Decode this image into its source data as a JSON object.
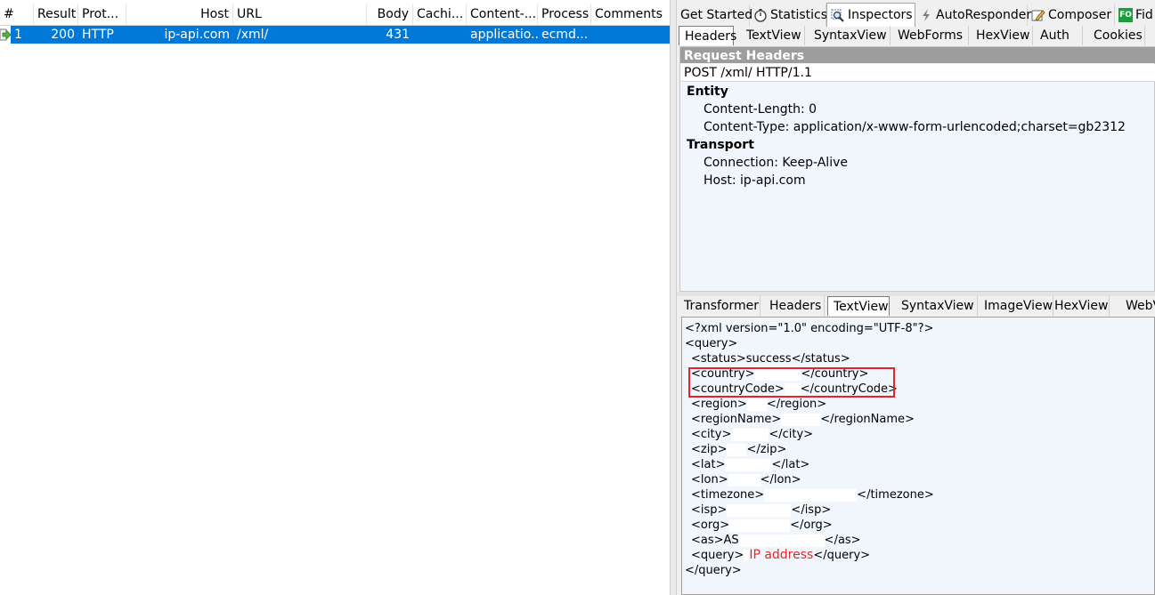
{
  "sessions": {
    "columns": [
      "#",
      "Result",
      "Prot...",
      "Host",
      "URL",
      "Body",
      "Cachi...",
      "Content-...",
      "Process",
      "Comments"
    ],
    "rows": [
      {
        "num": "1",
        "result": "200",
        "protocol": "HTTP",
        "host": "ip-api.com",
        "url": "/xml/",
        "body": "431",
        "caching": "",
        "content_type": "applicatio...",
        "process": "ecmd...",
        "comments": ""
      }
    ],
    "row_icon": "response-arrow-icon"
  },
  "inspector": {
    "main_tabs": [
      {
        "label": "Get Started",
        "icon": ""
      },
      {
        "label": "Statistics",
        "icon": "stopwatch-icon"
      },
      {
        "label": "Inspectors",
        "icon": "magnifier-icon",
        "active": true
      },
      {
        "label": "AutoResponder",
        "icon": "lightning-icon"
      },
      {
        "label": "Composer",
        "icon": "pencil-icon"
      },
      {
        "label": "Fid",
        "icon": "fo-icon",
        "icon_text": "FO"
      }
    ],
    "request_tabs": [
      "Headers",
      "TextView",
      "SyntaxView",
      "WebForms",
      "HexView",
      "Auth",
      "Cookies"
    ],
    "request_active": "Headers",
    "request": {
      "title": "Request Headers",
      "request_line": "POST /xml/ HTTP/1.1",
      "groups": [
        {
          "name": "Entity",
          "headers": [
            "Content-Length: 0",
            "Content-Type: application/x-www-form-urlencoded;charset=gb2312"
          ]
        },
        {
          "name": "Transport",
          "headers": [
            "Connection: Keep-Alive",
            "Host: ip-api.com"
          ]
        }
      ]
    },
    "response_tabs": [
      "Transformer",
      "Headers",
      "TextView",
      "SyntaxView",
      "ImageView",
      "HexView",
      "WebV"
    ],
    "response_active": "TextView",
    "response_xml": {
      "decl": "<?xml version=\"1.0\" encoding=\"UTF-8\"?>",
      "open_query": "<query>",
      "status": "<status>success</status>",
      "country_open": "<country>",
      "country_close": "</country>",
      "countryCode_open": "<countryCode>",
      "countryCode_close": "</countryCode>",
      "region_open": "<region>",
      "region_close": "</region>",
      "regionName_open": "<regionName>",
      "regionName_close": "</regionName>",
      "city_open": "<city>",
      "city_close": "</city>",
      "zip_open": "<zip>",
      "zip_close": "</zip>",
      "lat_open": "<lat>",
      "lat_close": "</lat>",
      "lon_open": "<lon>",
      "lon_close": "</lon>",
      "timezone_open": "<timezone>",
      "timezone_close": "</timezone>",
      "isp_open": "<isp>",
      "isp_close": "</isp>",
      "org_open": "<org>",
      "org_close": "</org>",
      "as_open": "<as>AS",
      "as_close": "</as>",
      "query_open": "<query>",
      "query_close": "</query>",
      "close_query": "</query>",
      "ip_label": "IP address"
    },
    "highlight_color": "#e3242b",
    "selection_color": "#0078d7"
  }
}
